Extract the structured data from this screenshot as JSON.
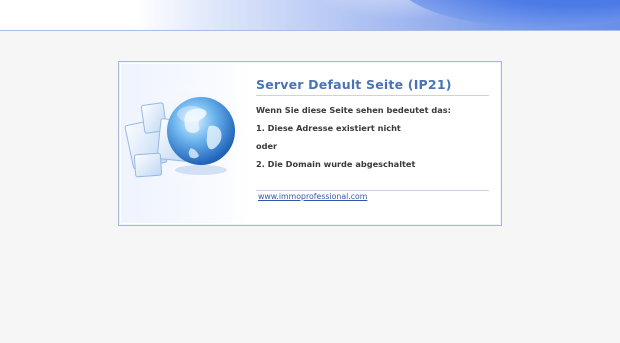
{
  "page": {
    "title": "Server Default Seite (IP21)",
    "intro": "Wenn Sie diese Seite sehen bedeutet das:",
    "reason1": "1. Diese Adresse existiert nicht",
    "or": "oder",
    "reason2": "2. Die Domain wurde abgeschaltet",
    "link": "www.immoprofessional.com"
  },
  "colors": {
    "title": "#4a73b7",
    "border": "#a6b8e0",
    "background": "#f6f6f6",
    "header_blue": "#3b6fe3"
  },
  "icons": {
    "hero": "globe-documents-icon"
  }
}
